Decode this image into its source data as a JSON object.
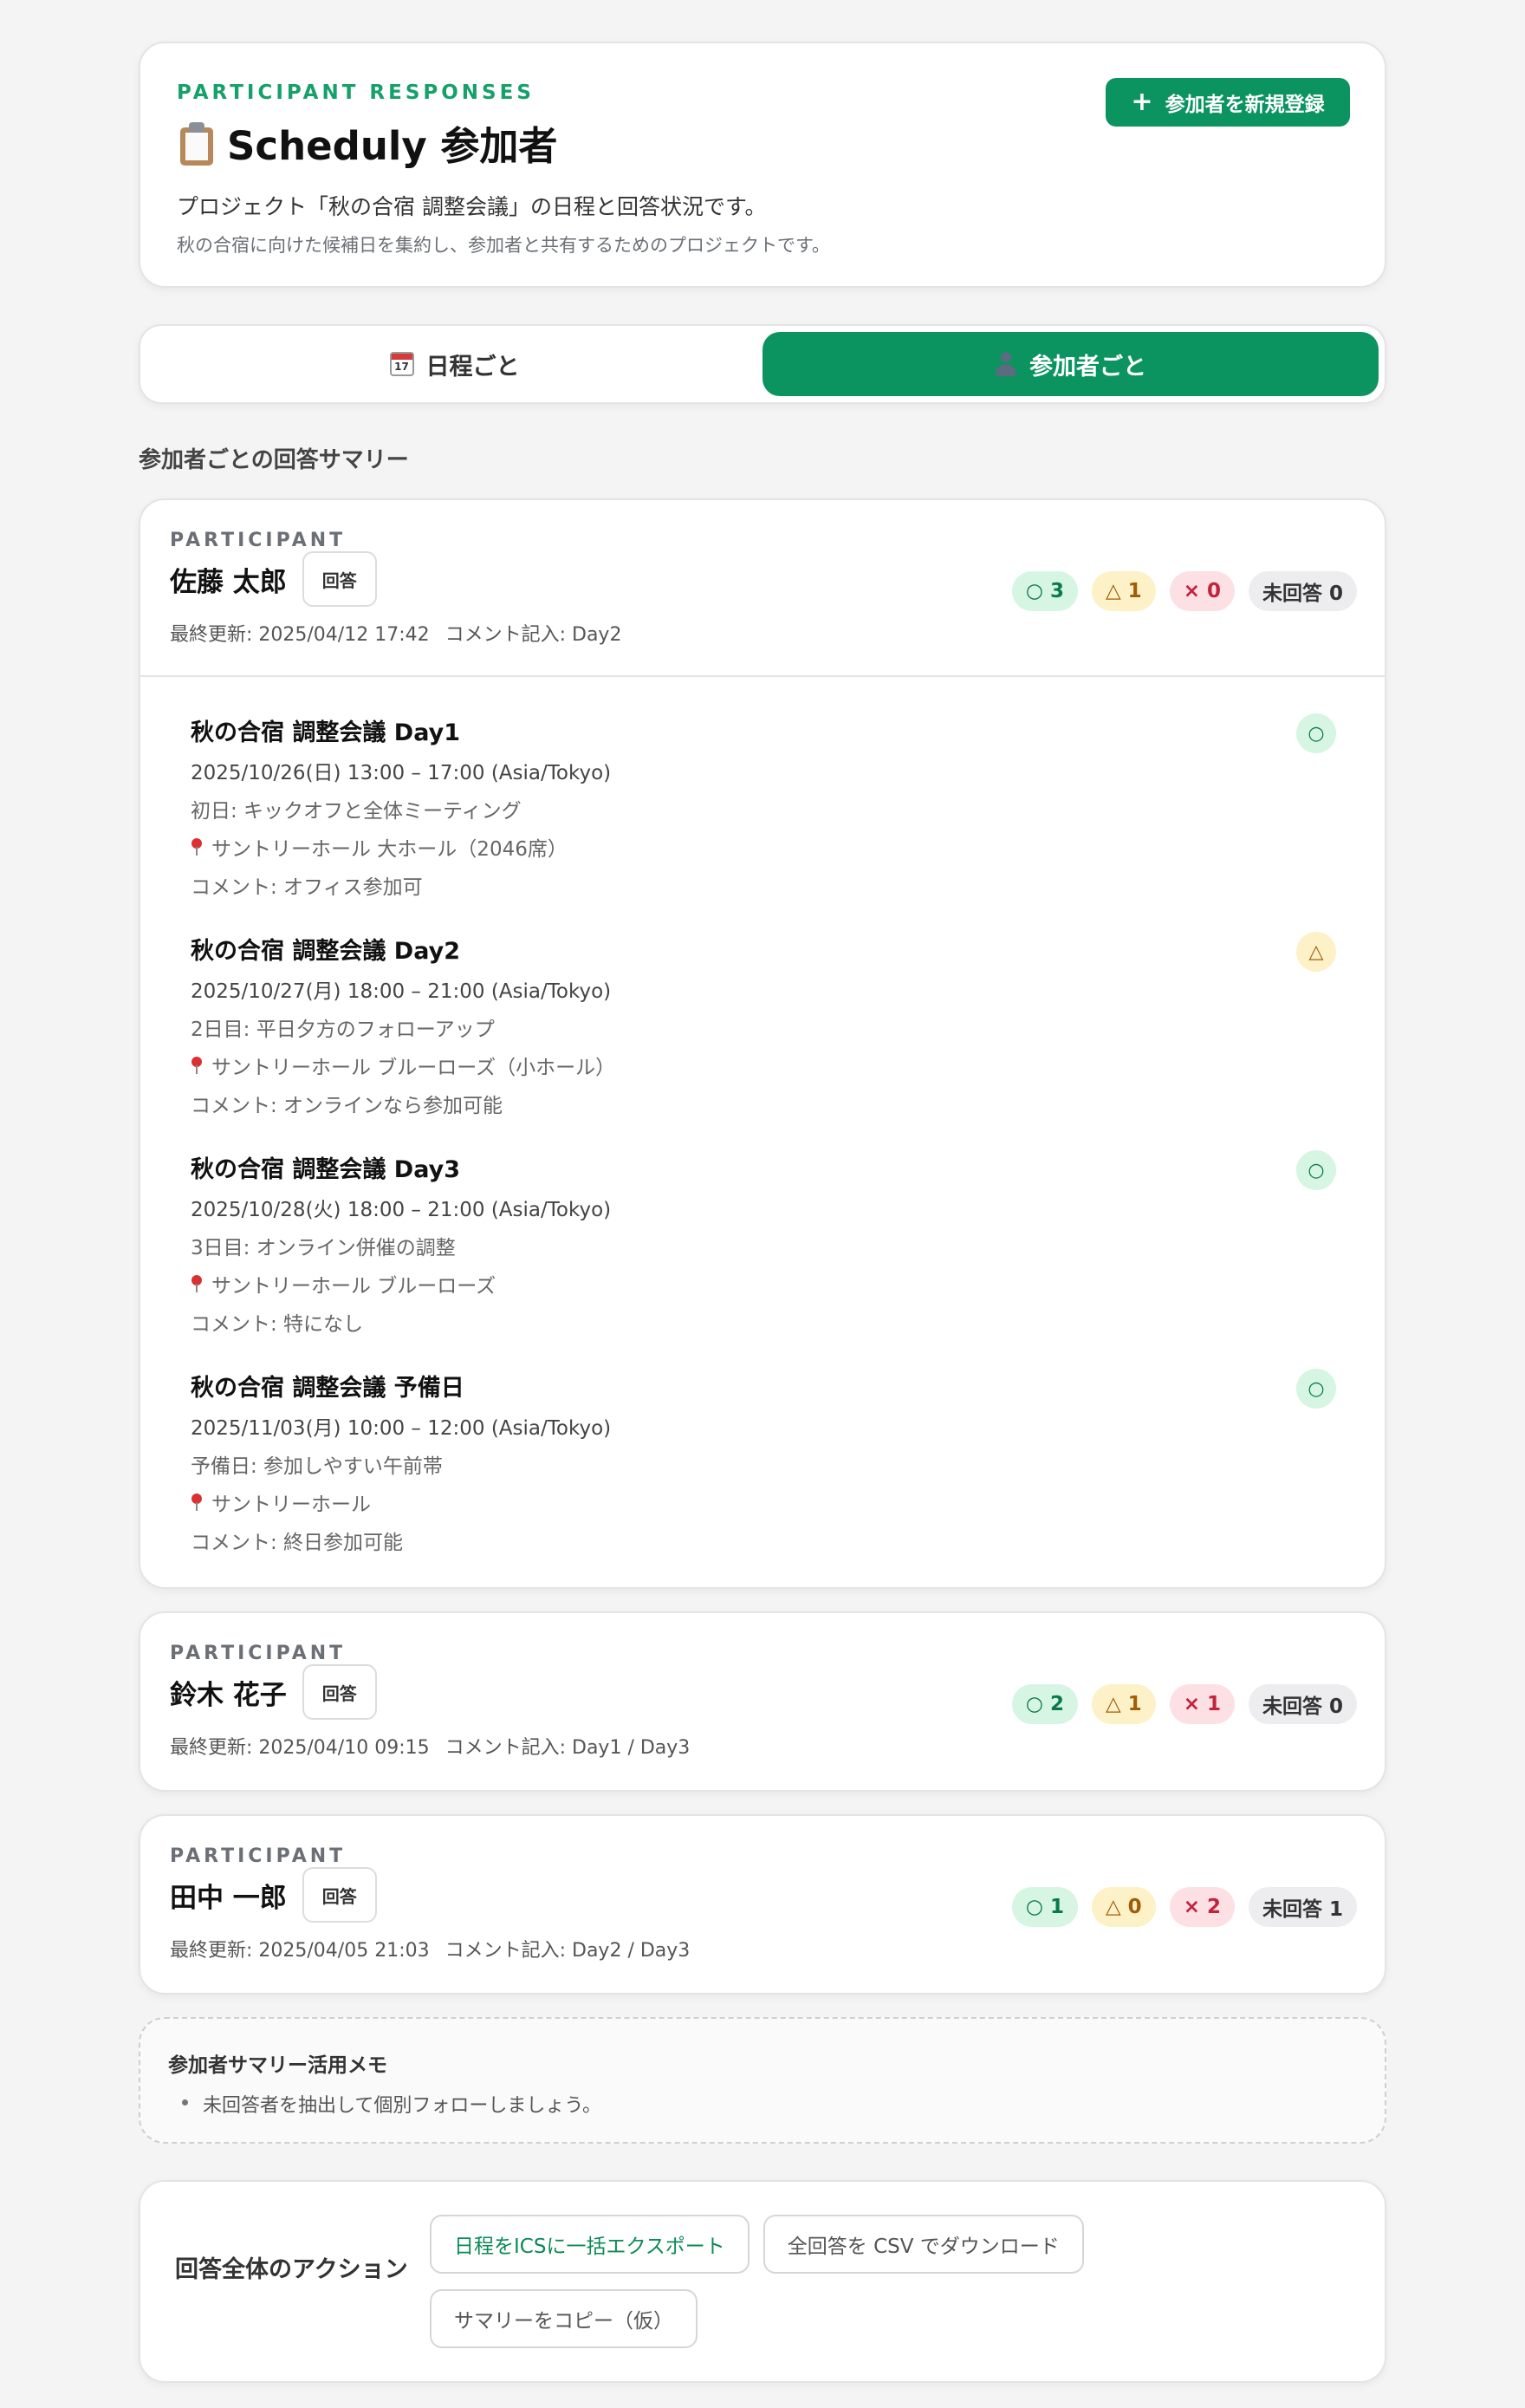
{
  "header": {
    "eyebrow": "PARTICIPANT RESPONSES",
    "title": "Scheduly 参加者",
    "description": "プロジェクト「秋の合宿 調整会議」の日程と回答状況です。",
    "subdescription": "秋の合宿に向けた候補日を集約し、参加者と共有するためのプロジェクトです。",
    "new_participant_label": "参加者を新規登録",
    "icon": "clipboard-icon"
  },
  "tabs": [
    {
      "label": "日程ごと",
      "icon": "calendar-icon",
      "active": false
    },
    {
      "label": "参加者ごと",
      "icon": "person-icon",
      "active": true
    }
  ],
  "section_title": "参加者ごとの回答サマリー",
  "participants": [
    {
      "label": "PARTICIPANT",
      "name": "佐藤 太郎",
      "answer_label": "回答",
      "updated": "最終更新: 2025/04/12 17:42",
      "comments": "コメント記入: Day2",
      "counts": {
        "ok": "○ 3",
        "maybe": "△ 1",
        "no": "× 0",
        "none": "未回答 0"
      },
      "schedules": [
        {
          "title": "秋の合宿 調整会議 Day1",
          "datetime": "2025/10/26(日) 13:00 – 17:00 (Asia/Tokyo)",
          "note": "初日: キックオフと全体ミーティング",
          "location": "サントリーホール 大ホール（2046席）",
          "comment": "コメント: オフィス参加可",
          "response": "○"
        },
        {
          "title": "秋の合宿 調整会議 Day2",
          "datetime": "2025/10/27(月) 18:00 – 21:00 (Asia/Tokyo)",
          "note": "2日目: 平日夕方のフォローアップ",
          "location": "サントリーホール ブルーローズ（小ホール）",
          "comment": "コメント: オンラインなら参加可能",
          "response": "△"
        },
        {
          "title": "秋の合宿 調整会議 Day3",
          "datetime": "2025/10/28(火) 18:00 – 21:00 (Asia/Tokyo)",
          "note": "3日目: オンライン併催の調整",
          "location": "サントリーホール ブルーローズ",
          "comment": "コメント: 特になし",
          "response": "○"
        },
        {
          "title": "秋の合宿 調整会議 予備日",
          "datetime": "2025/11/03(月) 10:00 – 12:00 (Asia/Tokyo)",
          "note": "予備日: 参加しやすい午前帯",
          "location": "サントリーホール",
          "comment": "コメント: 終日参加可能",
          "response": "○"
        }
      ]
    },
    {
      "label": "PARTICIPANT",
      "name": "鈴木 花子",
      "answer_label": "回答",
      "updated": "最終更新: 2025/04/10 09:15",
      "comments": "コメント記入: Day1 / Day3",
      "counts": {
        "ok": "○ 2",
        "maybe": "△ 1",
        "no": "× 1",
        "none": "未回答 0"
      }
    },
    {
      "label": "PARTICIPANT",
      "name": "田中 一郎",
      "answer_label": "回答",
      "updated": "最終更新: 2025/04/05 21:03",
      "comments": "コメント記入: Day2 / Day3",
      "counts": {
        "ok": "○ 1",
        "maybe": "△ 0",
        "no": "× 2",
        "none": "未回答 1"
      }
    }
  ],
  "memo": {
    "title": "参加者サマリー活用メモ",
    "items": [
      "未回答者を抽出して個別フォローしましょう。"
    ]
  },
  "actions": {
    "label": "回答全体のアクション",
    "export_ics": "日程をICSに一括エクスポート",
    "download_csv": "全回答を CSV でダウンロード",
    "copy_summary": "サマリーをコピー（仮）"
  },
  "colors": {
    "accent": "#0b9460",
    "ok_bg": "#d6f5e3",
    "maybe_bg": "#fdf1c7",
    "no_bg": "#fde0e3",
    "none_bg": "#ededef"
  }
}
